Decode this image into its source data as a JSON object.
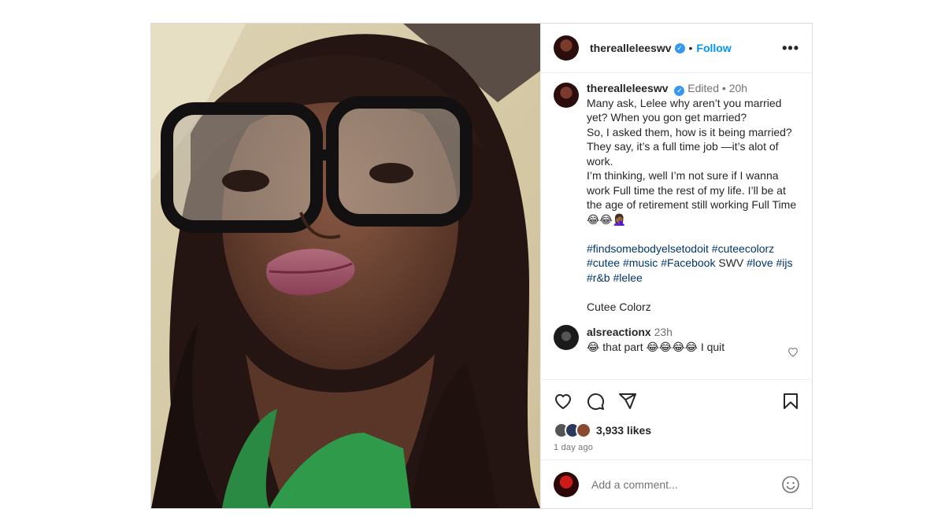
{
  "header": {
    "username": "therealleleeswv",
    "follow_label": "Follow",
    "separator": "•",
    "more_label": "•••"
  },
  "caption": {
    "username": "therealleleeswv",
    "edited": "Edited",
    "separator": "•",
    "time": "20h",
    "text": "Many ask, Lelee why aren’t you married yet? When you gon get married?\nSo, I asked them, how is it being married?\nThey say, it’s a full time job —it’s alot of work.\nI’m thinking, well I’m not sure if I wanna work Full time the rest of my life. I’ll be at the age of retirement still working Full Time 😂😂🤦🏾‍♀️",
    "tags": {
      "t1": "#findsomebodyelsetodoit",
      "t2": "#cuteecolorz",
      "t3": "#cutee",
      "t4": "#music",
      "t5": "#Facebook",
      "swv": "SWV",
      "t6": "#love",
      "t7": "#ijs",
      "t8": "#r&b",
      "t9": "#lelee"
    },
    "credit": "Cutee Colorz"
  },
  "comment": {
    "username": "alsreactionx",
    "time": "23h",
    "text": "😂 that part 😂😂😂😂 I quit"
  },
  "likes": "3,933 likes",
  "posted_ago": "1 day ago",
  "add_comment": {
    "placeholder": "Add a comment..."
  },
  "colors": {
    "link": "#0095f6",
    "hashtag": "#00376b",
    "verified": "#3897f0"
  },
  "icons": [
    "heart-icon",
    "comment-icon",
    "share-icon",
    "bookmark-icon",
    "emoji-icon",
    "more-icon",
    "verified-icon"
  ]
}
